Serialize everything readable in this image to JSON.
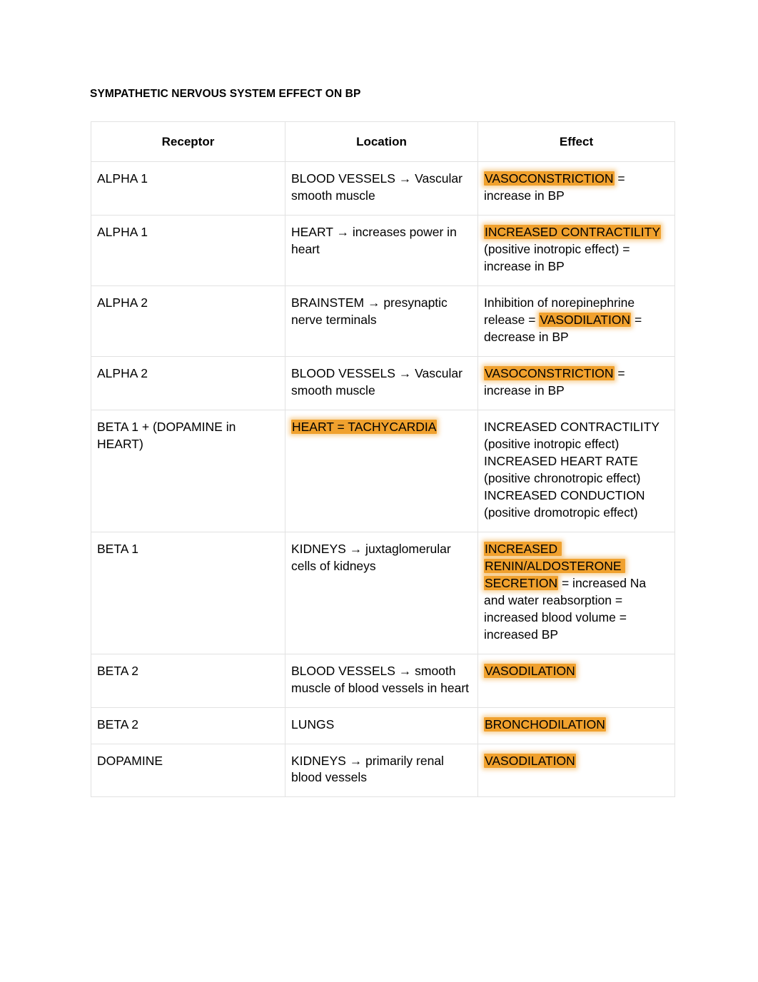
{
  "document": {
    "title": "SYMPATHETIC NERVOUS SYSTEM EFFECT ON BP"
  },
  "colors": {
    "highlight": "#f0a12e",
    "text": "#000000",
    "border": "#e2e2e2",
    "background": "#ffffff"
  },
  "table": {
    "headers": {
      "receptor": "Receptor",
      "location": "Location",
      "effect": "Effect"
    },
    "rows": [
      {
        "receptor": "ALPHA 1",
        "location": "BLOOD VESSELS → Vascular smooth muscle",
        "effect_highlight": "VASOCONSTRICTION",
        "effect_rest": " = increase in BP",
        "effect_full": "VASOCONSTRICTION = increase in BP"
      },
      {
        "receptor": "ALPHA 1",
        "location": "HEART → increases power in heart",
        "effect_highlight": "INCREASED CONTRACTILITY",
        "effect_rest": " (positive inotropic effect) = increase in BP",
        "effect_full": "INCREASED CONTRACTILITY (positive inotropic effect) = increase in BP"
      },
      {
        "receptor": "ALPHA 2",
        "location": "BRAINSTEM → presynaptic nerve terminals",
        "effect_prefix": "Inhibition of norepinephrine release = ",
        "effect_highlight": "VASODILATION",
        "effect_rest": " = decrease in BP",
        "effect_full": "Inhibition of norepinephrine release = VASODILATION = decrease in BP"
      },
      {
        "receptor": "ALPHA 2",
        "location": "BLOOD VESSELS → Vascular smooth muscle",
        "effect_highlight": "VASOCONSTRICTION",
        "effect_rest": " = increase in BP",
        "effect_full": "VASOCONSTRICTION = increase in BP"
      },
      {
        "receptor": "BETA 1 + (DOPAMINE in HEART)",
        "location_highlight": "HEART = TACHYCARDIA",
        "location": "HEART = TACHYCARDIA",
        "effect_full": "INCREASED CONTRACTILITY (positive inotropic effect)\nINCREASED HEART RATE (positive chronotropic effect)\nINCREASED CONDUCTION (positive dromotropic effect)"
      },
      {
        "receptor": "BETA 1",
        "location": "KIDNEYS → juxtaglomerular cells of kidneys",
        "effect_highlight": "INCREASED RENIN/ALDOSTERONE SECRETION",
        "effect_rest": " = increased Na and water reabsorption = increased blood volume = increased BP",
        "effect_full": "INCREASED RENIN/ALDOSTERONE SECRETION = increased Na and water reabsorption = increased blood volume = increased BP"
      },
      {
        "receptor": "BETA 2",
        "location": "BLOOD VESSELS → smooth muscle of blood vessels in heart",
        "effect_highlight": "VASODILATION",
        "effect_rest": "",
        "effect_full": "VASODILATION"
      },
      {
        "receptor": "BETA 2",
        "location": "LUNGS",
        "effect_highlight": "BRONCHODILATION",
        "effect_rest": "",
        "effect_full": "BRONCHODILATION"
      },
      {
        "receptor": "DOPAMINE",
        "location": "KIDNEYS → primarily renal blood vessels",
        "effect_highlight": "VASODILATION",
        "effect_rest": "",
        "effect_full": "VASODILATION"
      }
    ]
  }
}
